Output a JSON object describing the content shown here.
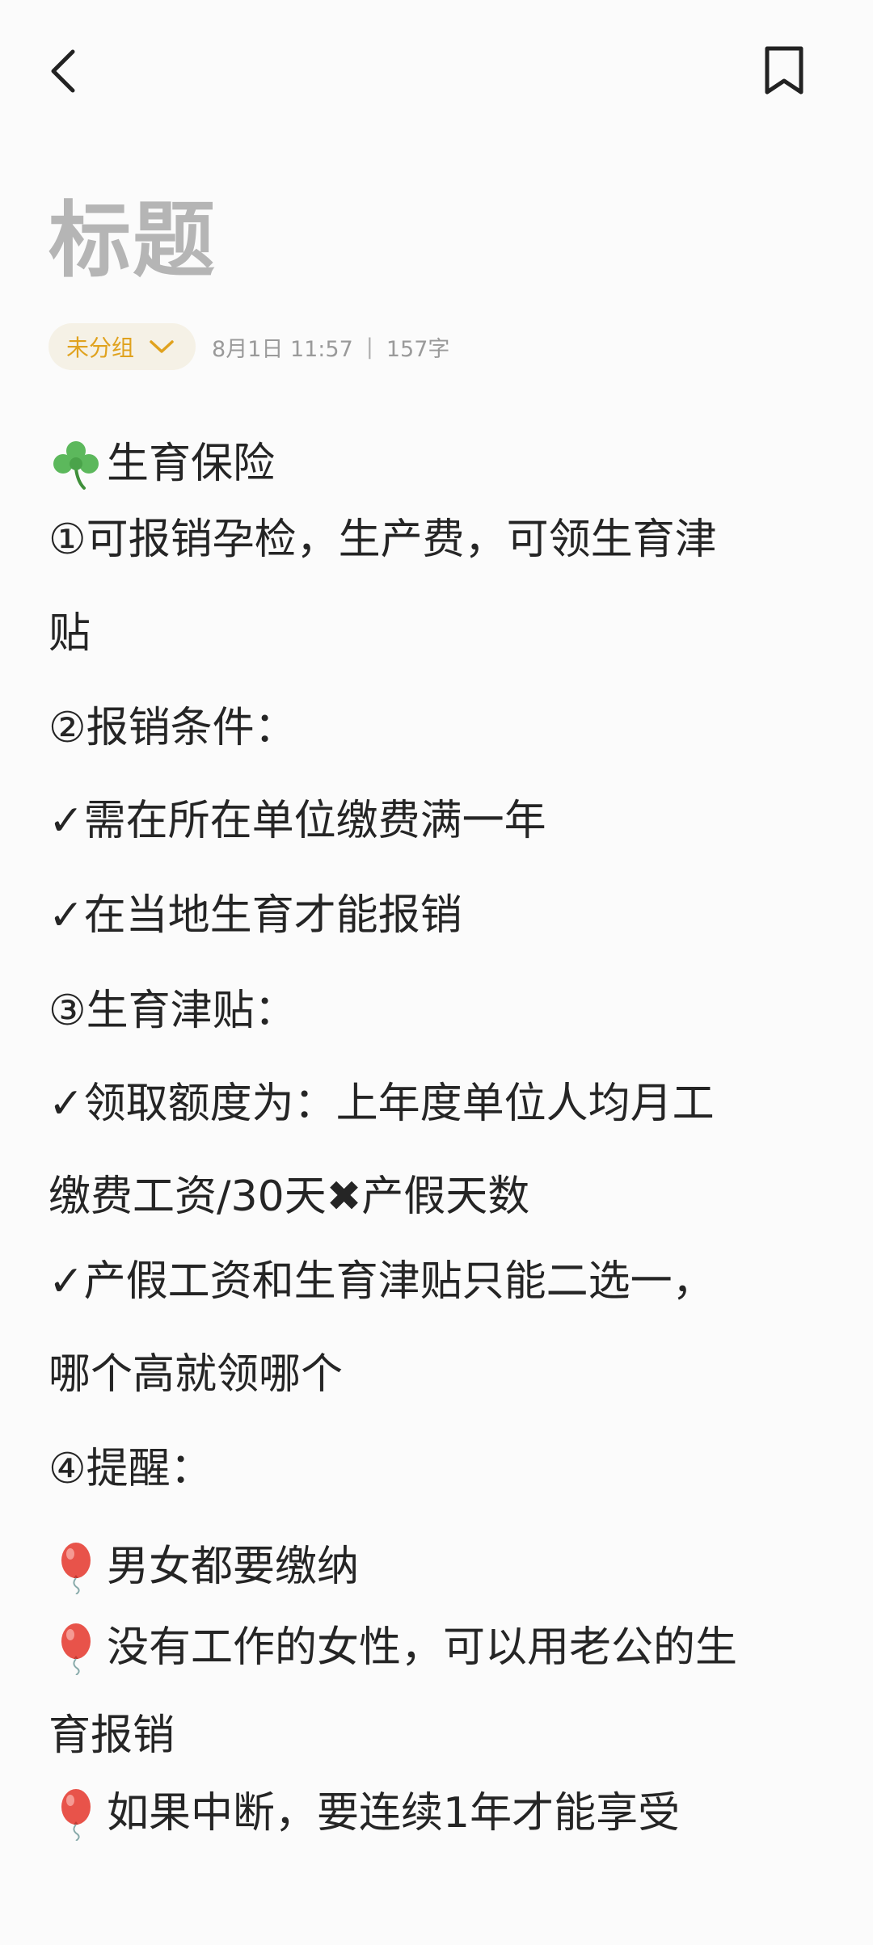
{
  "note": {
    "title": "标题",
    "group": "未分组",
    "date": "8月1日 11:57",
    "separator": "|",
    "word_count": "157字"
  },
  "content": {
    "lines": [
      "生育保险",
      "①可报销孕检，生产费，可领生育津",
      "贴",
      "②报销条件：",
      "✓需在所在单位缴费满一年",
      "✓在当地生育才能报销",
      "③生育津贴：",
      "✓领取额度为：上年度单位人均月工",
      "缴费工资/30天✖产假天数",
      "✓产假工资和生育津贴只能二选一，",
      "哪个高就领哪个",
      "④提醒：",
      "男女都要缴纳",
      "没有工作的女性，可以用老公的生",
      "育报销",
      "如果中断，要连续1年才能享受"
    ]
  },
  "icons": {
    "back": "back-arrow-icon",
    "bookmark": "bookmark-icon",
    "dropdown": "chevron-down-icon",
    "clover": "clover-icon",
    "balloon": "balloon-icon"
  },
  "colors": {
    "background": "#fbfbfb",
    "title": "#b5b5b5",
    "accent": "#e0a21e",
    "chip_bg": "#f5f1e6",
    "meta": "#9a9a9a",
    "text": "#252525",
    "clover": "#5cb85c",
    "balloon": "#e8534a"
  }
}
